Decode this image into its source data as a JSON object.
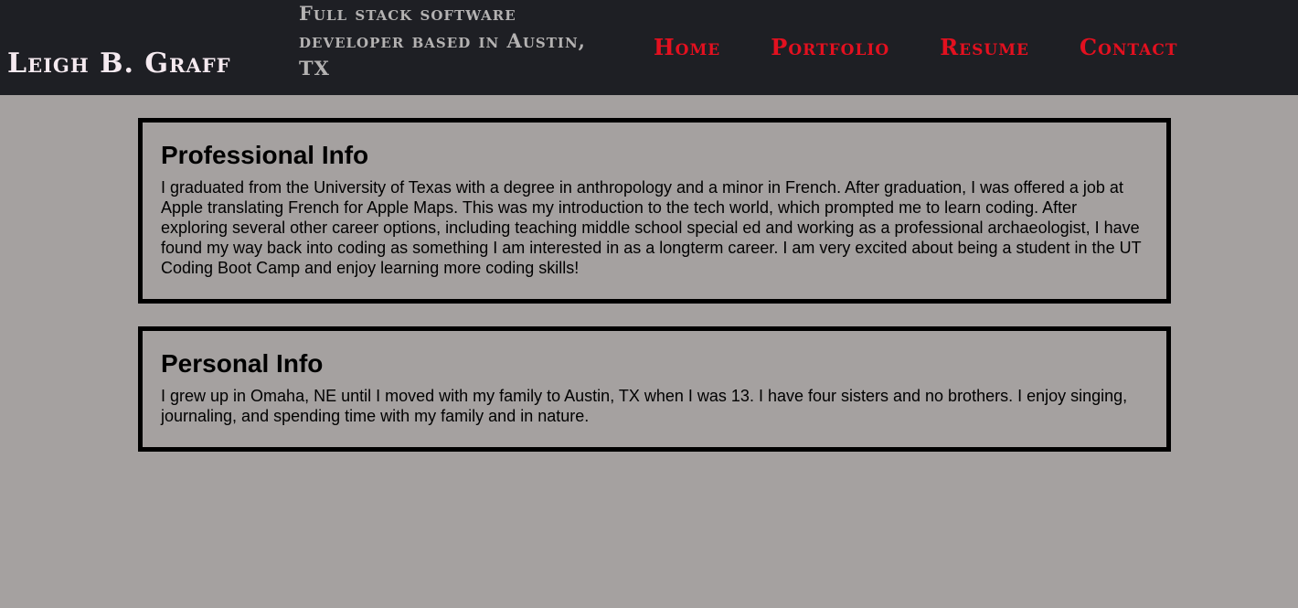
{
  "header": {
    "site_name": "Leigh B. Graff",
    "tagline": "Full stack software developer based in Austin, TX",
    "nav": [
      "Home",
      "Portfolio",
      "Resume",
      "Contact"
    ]
  },
  "sections": {
    "professional": {
      "title": "Professional Info",
      "body": "I graduated from the University of Texas with a degree in anthropology and a minor in French. After graduation, I was offered a job at Apple translating French for Apple Maps. This was my introduction to the tech world, which prompted me to learn coding. After exploring several other career options, including teaching middle school special ed and working as a professional archaeologist, I have found my way back into coding as something I am interested in as a longterm career. I am very excited about being a student in the UT Coding Boot Camp and enjoy learning more coding skills!"
    },
    "personal": {
      "title": "Personal Info",
      "body": "I grew up in Omaha, NE until I moved with my family to Austin, TX when I was 13. I have four sisters and no brothers. I enjoy singing, journaling, and spending time with my family and in nature."
    }
  },
  "colors": {
    "header_bg": "#1e1f24",
    "page_bg": "#a5a1a0",
    "nav_link": "#e3101f",
    "site_name": "#f5eaf0",
    "tagline": "#b4b2b2"
  }
}
